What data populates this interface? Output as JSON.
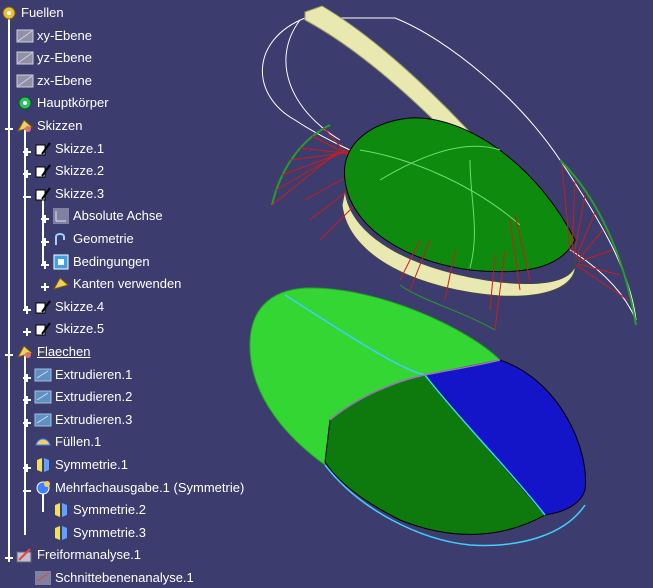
{
  "tree": {
    "root": {
      "label": "Fuellen",
      "icon": "part-gear-icon"
    },
    "items": [
      {
        "label": "xy-Ebene",
        "icon": "plane-icon"
      },
      {
        "label": "yz-Ebene",
        "icon": "plane-icon"
      },
      {
        "label": "zx-Ebene",
        "icon": "plane-icon"
      },
      {
        "label": "Hauptkörper",
        "icon": "body-gear-icon"
      },
      {
        "label": "Skizzen",
        "icon": "geometric-set-icon"
      },
      {
        "label": "Skizze.1",
        "icon": "sketch-icon"
      },
      {
        "label": "Skizze.2",
        "icon": "sketch-icon"
      },
      {
        "label": "Skizze.3",
        "icon": "sketch-icon"
      },
      {
        "label": "Absolute Achse",
        "icon": "axis-icon"
      },
      {
        "label": "Geometrie",
        "icon": "geometry-icon"
      },
      {
        "label": "Bedingungen",
        "icon": "constraints-icon"
      },
      {
        "label": "Kanten verwenden",
        "icon": "use-edges-icon"
      },
      {
        "label": "Skizze.4",
        "icon": "sketch-icon"
      },
      {
        "label": "Skizze.5",
        "icon": "sketch-icon"
      },
      {
        "label": "Flaechen",
        "icon": "geometric-set-icon"
      },
      {
        "label": "Extrudieren.1",
        "icon": "extrude-icon"
      },
      {
        "label": "Extrudieren.2",
        "icon": "extrude-icon"
      },
      {
        "label": "Extrudieren.3",
        "icon": "extrude-icon"
      },
      {
        "label": "Füllen.1",
        "icon": "fill-icon"
      },
      {
        "label": "Symmetrie.1",
        "icon": "symmetry-icon"
      },
      {
        "label": "Mehrfachausgabe.1 (Symmetrie)",
        "icon": "multi-output-icon"
      },
      {
        "label": "Symmetrie.2",
        "icon": "symmetry-icon"
      },
      {
        "label": "Symmetrie.3",
        "icon": "symmetry-icon"
      },
      {
        "label": "Freiformanalyse.1",
        "icon": "freeform-analysis-icon"
      },
      {
        "label": "Schnittebenenanalyse.1",
        "icon": "cutting-plane-analysis-icon"
      }
    ]
  },
  "colors": {
    "background": "#3c3c6e",
    "surface_green": "#33d633",
    "surface_dark_green": "#0e7a0e",
    "surface_blue": "#1010c8",
    "porcupine_red": "#c81e1e",
    "tree_text": "#ffffff"
  }
}
